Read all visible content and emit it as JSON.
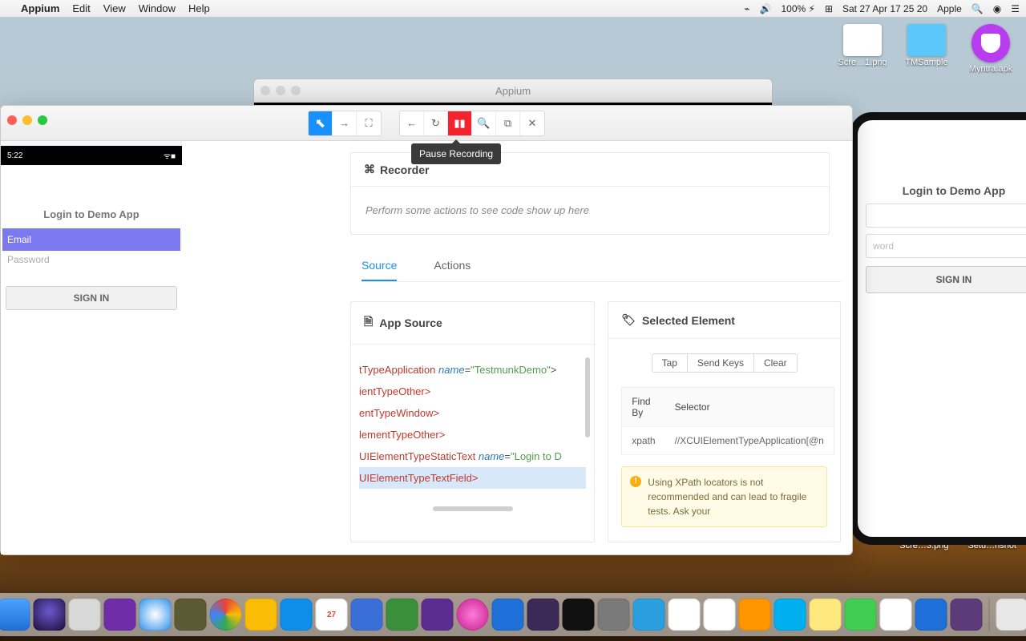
{
  "menubar": {
    "app": "Appium",
    "items": [
      "Edit",
      "View",
      "Window",
      "Help"
    ],
    "battery": "100%",
    "date": "Sat 27 Apr  17 25 20",
    "user": "Apple"
  },
  "desktop": {
    "icon1": "Scre…1.png",
    "icon2": "TMSample",
    "icon3": "Myntra.apk",
    "icon4": "Scre…3.png",
    "icon5": "Setu…nshot"
  },
  "bg_window": {
    "title": "Appium"
  },
  "sim_right": {
    "title": "Login to Demo App",
    "pwd_placeholder": "word",
    "signin": "SIGN IN"
  },
  "inspector": {
    "tooltip": "Pause Recording",
    "recorder": {
      "title": "Recorder",
      "hint": "Perform some actions to see code show up here"
    },
    "tabs": {
      "source": "Source",
      "actions": "Actions"
    },
    "phone": {
      "time": "5:22",
      "apptitle": "Login to Demo App",
      "email_placeholder": "Email",
      "password_placeholder": "Password",
      "signin": "SIGN IN"
    },
    "appsource": {
      "title": "App Source",
      "l1_tag": "tTypeApplication",
      "l1_attr": "name",
      "l1_val": "\"TestmunkDemo\"",
      "l2": "ientTypeOther>",
      "l3": "entTypeWindow>",
      "l4": "lementTypeOther>",
      "l5_tag": "UIElementTypeStaticText",
      "l5_attr": "name",
      "l5_val": "\"Login to D",
      "l6": "UIElementTypeTextField>"
    },
    "selected": {
      "title": "Selected Element",
      "btn_tap": "Tap",
      "btn_send": "Send Keys",
      "btn_clear": "Clear",
      "th1": "Find By",
      "th2": "Selector",
      "td1": "xpath",
      "td2": "//XCUIElementTypeApplication[@n",
      "warn": "Using XPath locators is not recommended and can lead to fragile tests. Ask your"
    }
  }
}
